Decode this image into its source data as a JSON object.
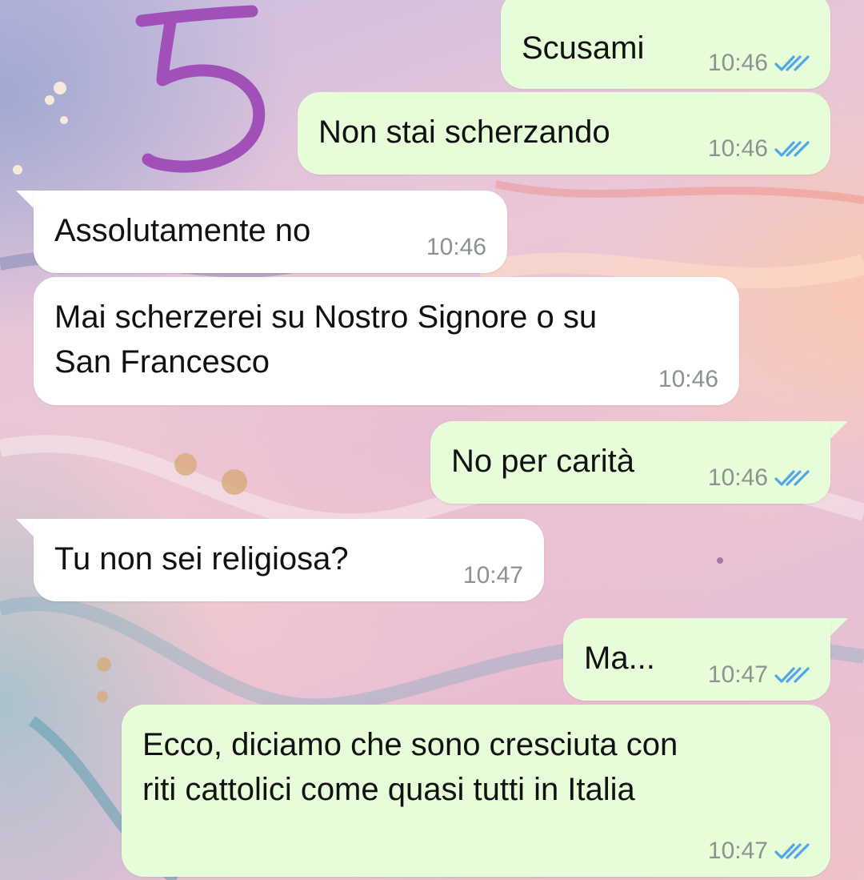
{
  "annotation": {
    "number": "5",
    "color": "#a050b8"
  },
  "colors": {
    "outgoing_bubble": "#e7fcd9",
    "incoming_bubble": "#ffffff",
    "read_ticks": "#4fa7e8",
    "timestamp": "#8a948e"
  },
  "messages": [
    {
      "direction": "outgoing",
      "lines": [
        "Scusami"
      ],
      "time": "10:46",
      "status": "read"
    },
    {
      "direction": "outgoing",
      "lines": [
        "Non stai scherzando"
      ],
      "time": "10:46",
      "status": "read"
    },
    {
      "direction": "incoming",
      "lines": [
        "Assolutamente no"
      ],
      "time": "10:46"
    },
    {
      "direction": "incoming",
      "lines": [
        "Mai scherzerei su Nostro Signore o su",
        "San Francesco"
      ],
      "time": "10:46"
    },
    {
      "direction": "outgoing",
      "lines": [
        "No per carità"
      ],
      "time": "10:46",
      "status": "read"
    },
    {
      "direction": "incoming",
      "lines": [
        "Tu non sei religiosa?"
      ],
      "time": "10:47"
    },
    {
      "direction": "outgoing",
      "lines": [
        "Ma..."
      ],
      "time": "10:47",
      "status": "read"
    },
    {
      "direction": "outgoing",
      "lines": [
        "Ecco, diciamo che sono cresciuta con",
        "riti cattolici come quasi tutti in Italia"
      ],
      "time": "10:47",
      "status": "read"
    }
  ]
}
